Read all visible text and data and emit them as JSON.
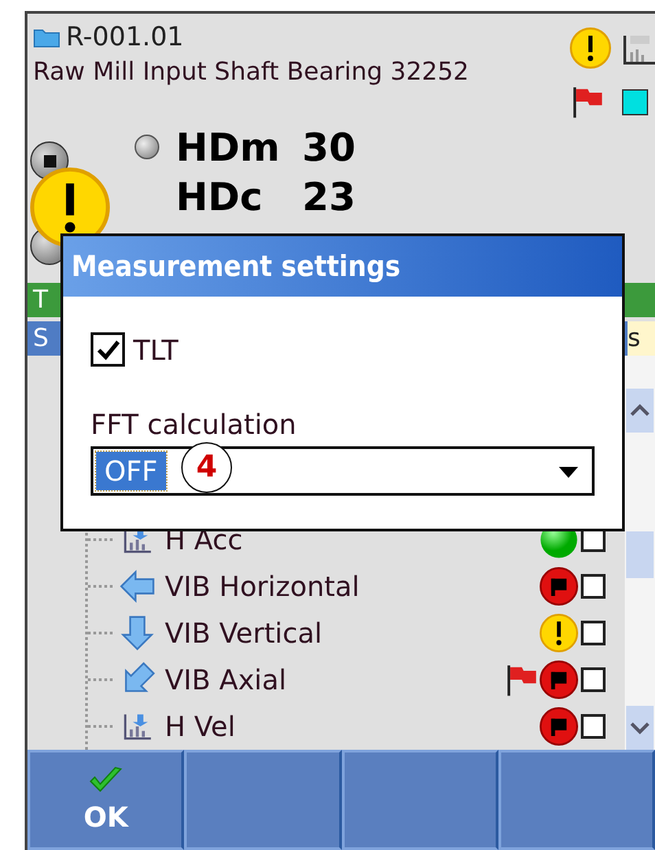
{
  "header": {
    "code": "R-001.01",
    "name": "Raw Mill Input Shaft Bearing 32252"
  },
  "readings": [
    {
      "label": "HDm",
      "value": "30",
      "indicator": true
    },
    {
      "label": "HDc",
      "value": "23",
      "indicator": false
    }
  ],
  "green_bar": {
    "text": "T"
  },
  "section_bar": {
    "text": "S",
    "column_text": "s"
  },
  "tree": [
    {
      "label": "H Acc",
      "kind": "chart",
      "status": {
        "kind": "ok"
      },
      "flag": false,
      "checked": false
    },
    {
      "label": "VIB Horizontal",
      "kind": "arrow-left",
      "status": {
        "kind": "alarm"
      },
      "flag": false,
      "checked": false
    },
    {
      "label": "VIB Vertical",
      "kind": "arrow-down",
      "status": {
        "kind": "warning"
      },
      "flag": false,
      "checked": false
    },
    {
      "label": "VIB Axial",
      "kind": "arrow-diagonal",
      "status": {
        "kind": "alarm"
      },
      "flag": true,
      "checked": false
    },
    {
      "label": "H Vel",
      "kind": "chart",
      "status": {
        "kind": "alarm"
      },
      "flag": false,
      "checked": false
    }
  ],
  "dialog": {
    "title": "Measurement settings",
    "checkbox": {
      "label": "TLT",
      "checked": true
    },
    "field_label": "FFT calculation",
    "dropdown": {
      "value": "OFF"
    },
    "callout": "4"
  },
  "toolbar": [
    {
      "kind": "ok",
      "label": "OK"
    },
    {
      "kind": "blank"
    },
    {
      "kind": "blank"
    },
    {
      "kind": "blank"
    }
  ]
}
